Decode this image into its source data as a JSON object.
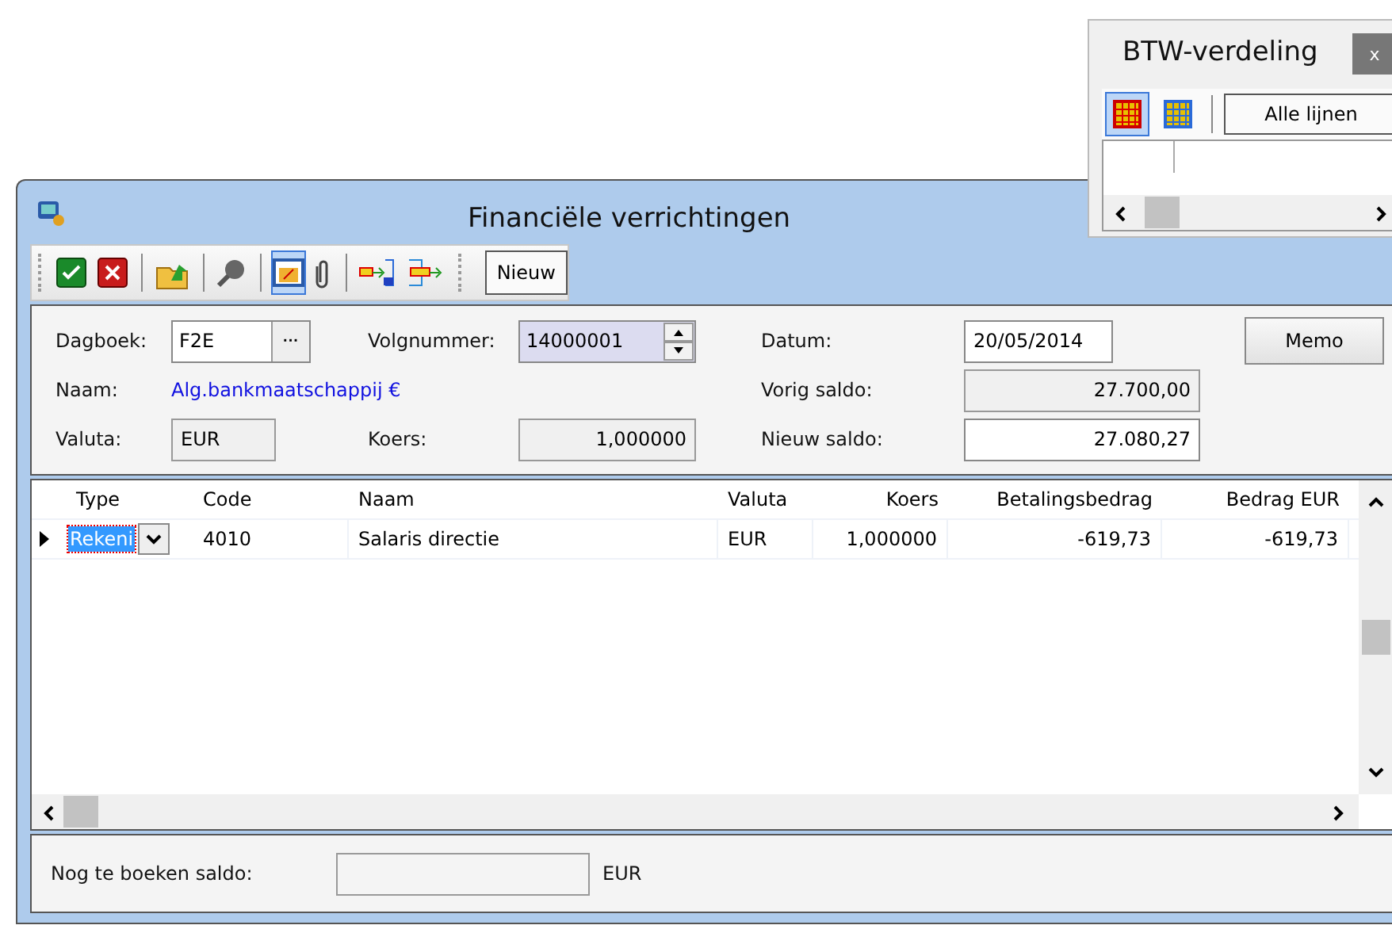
{
  "btw_panel": {
    "title": "BTW-verdeling",
    "close": "x",
    "tools": [
      {
        "kind": "grid-red",
        "selected": true
      },
      {
        "kind": "grid-blue",
        "selected": false
      }
    ],
    "filter_button": "Alle lijnen"
  },
  "window": {
    "title": "Financiële verrichtingen"
  },
  "toolbar": {
    "tool_groups": [
      [
        {
          "kind": "accept",
          "selected": false
        },
        {
          "kind": "cancel",
          "selected": false
        }
      ],
      [
        {
          "kind": "export",
          "selected": false
        }
      ],
      [
        {
          "kind": "search",
          "selected": false
        }
      ],
      [
        {
          "kind": "percent",
          "selected": true
        },
        {
          "kind": "attach",
          "selected": false
        }
      ],
      [
        {
          "kind": "insert-before",
          "selected": false
        },
        {
          "kind": "insert-after",
          "selected": false
        }
      ]
    ],
    "new_button": "Nieuw"
  },
  "form": {
    "dagboek": {
      "label": "Dagboek:",
      "value": "F2E",
      "browse": "···"
    },
    "volgnummer": {
      "label": "Volgnummer:",
      "value": "14000001"
    },
    "datum": {
      "label": "Datum:",
      "value": "20/05/2014"
    },
    "memo_button": "Memo",
    "naam": {
      "label": "Naam:",
      "value": "Alg.bankmaatschappij €"
    },
    "vorig_saldo": {
      "label": "Vorig saldo:",
      "value": "27.700,00"
    },
    "valuta": {
      "label": "Valuta:",
      "value": "EUR"
    },
    "koers": {
      "label": "Koers:",
      "value": "1,000000"
    },
    "nieuw_saldo": {
      "label": "Nieuw saldo:",
      "value": "27.080,27"
    }
  },
  "table": {
    "columns": [
      "Type",
      "Code",
      "Naam",
      "Valuta",
      "Koers",
      "Betalingsbedrag",
      "Bedrag EUR"
    ],
    "rows": [
      {
        "current": true,
        "cells": [
          "Rekeni",
          "4010",
          "Salaris directie",
          "EUR",
          "1,000000",
          "-619,73",
          "-619,73"
        ]
      }
    ]
  },
  "footer": {
    "label": "Nog te boeken saldo:",
    "currency": "EUR"
  }
}
